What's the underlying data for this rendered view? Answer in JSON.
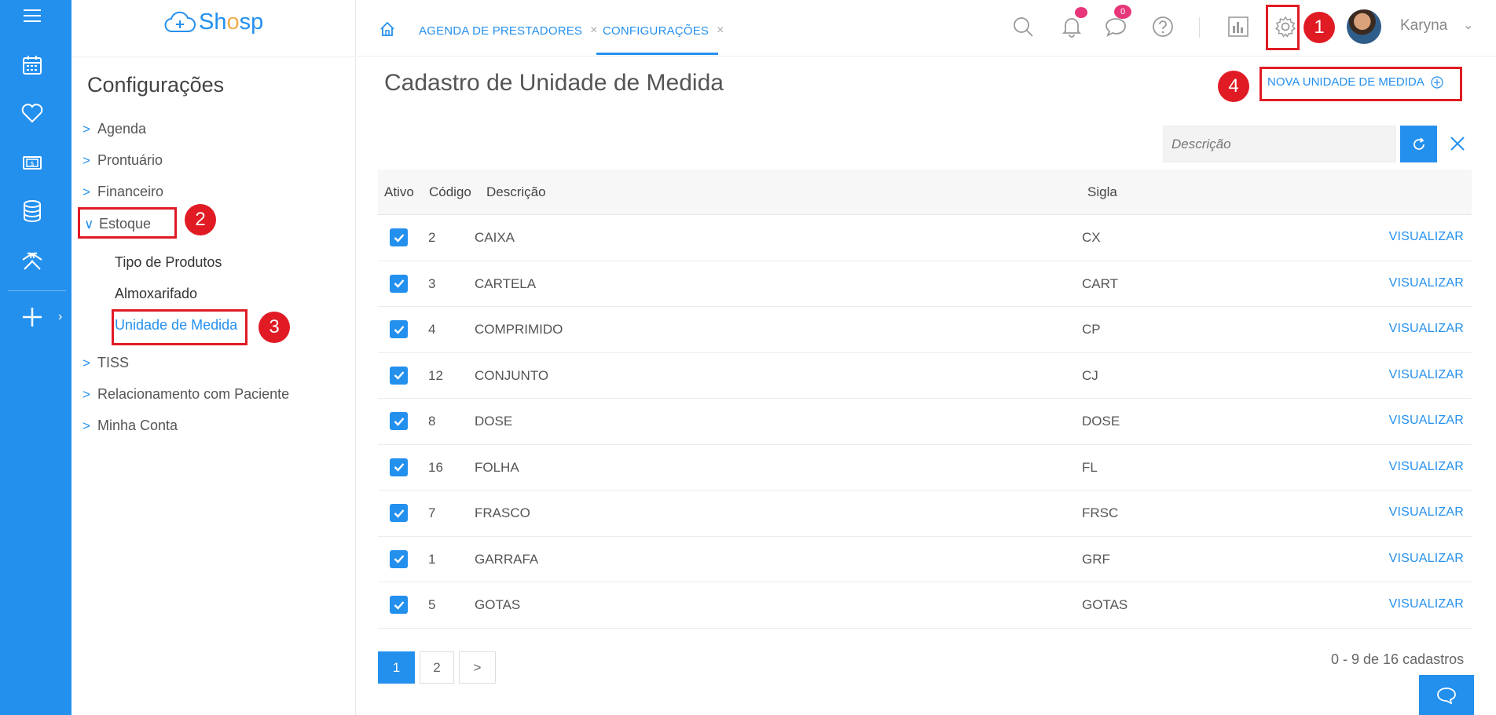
{
  "rail": {
    "icons": [
      "menu-icon",
      "calendar-icon",
      "heart-icon",
      "money-icon",
      "database-icon",
      "tools-icon",
      "plus-icon"
    ],
    "expand_chevron": "›"
  },
  "brand": {
    "logo_text_a": "Sh",
    "logo_text_b": "o",
    "logo_text_c": "sp"
  },
  "sidebar": {
    "title": "Configurações",
    "items": [
      {
        "label": "Agenda",
        "chev": ">"
      },
      {
        "label": "Prontuário",
        "chev": ">"
      },
      {
        "label": "Financeiro",
        "chev": ">"
      },
      {
        "label": "Estoque",
        "chev": "∨"
      },
      {
        "label": "TISS",
        "chev": ">"
      },
      {
        "label": "Relacionamento com Paciente",
        "chev": ">"
      },
      {
        "label": "Minha Conta",
        "chev": ">"
      }
    ],
    "sub_items": [
      "Tipo de Produtos",
      "Almoxarifado",
      "Unidade de Medida"
    ]
  },
  "topbar": {
    "tabs": [
      {
        "label": "AGENDA DE PRESTADORES",
        "close": "×"
      },
      {
        "label": "CONFIGURAÇÕES",
        "close": "×"
      }
    ],
    "messages_count": "0",
    "user_name": "Karyna",
    "user_chevron": "⌄"
  },
  "annotations": [
    "1",
    "2",
    "3",
    "4"
  ],
  "main": {
    "title": "Cadastro de Unidade de Medida",
    "new_button": "NOVA UNIDADE DE MEDIDA",
    "search_placeholder": "Descrição",
    "columns": [
      "Ativo",
      "Código",
      "Descrição",
      "Sigla"
    ],
    "rows": [
      {
        "codigo": "2",
        "descricao": "CAIXA",
        "sigla": "CX",
        "action": "VISUALIZAR"
      },
      {
        "codigo": "3",
        "descricao": "CARTELA",
        "sigla": "CART",
        "action": "VISUALIZAR"
      },
      {
        "codigo": "4",
        "descricao": "COMPRIMIDO",
        "sigla": "CP",
        "action": "VISUALIZAR"
      },
      {
        "codigo": "12",
        "descricao": "CONJUNTO",
        "sigla": "CJ",
        "action": "VISUALIZAR"
      },
      {
        "codigo": "8",
        "descricao": "DOSE",
        "sigla": "DOSE",
        "action": "VISUALIZAR"
      },
      {
        "codigo": "16",
        "descricao": "FOLHA",
        "sigla": "FL",
        "action": "VISUALIZAR"
      },
      {
        "codigo": "7",
        "descricao": "FRASCO",
        "sigla": "FRSC",
        "action": "VISUALIZAR"
      },
      {
        "codigo": "1",
        "descricao": "GARRAFA",
        "sigla": "GRF",
        "action": "VISUALIZAR"
      },
      {
        "codigo": "5",
        "descricao": "GOTAS",
        "sigla": "GOTAS",
        "action": "VISUALIZAR"
      }
    ],
    "pagination": [
      "1",
      "2",
      ">"
    ],
    "count_text": "0 - 9 de 16 cadastros"
  },
  "colors": {
    "accent": "#2490ee",
    "annotation": "#e01b24",
    "notification": "#e8367a"
  }
}
